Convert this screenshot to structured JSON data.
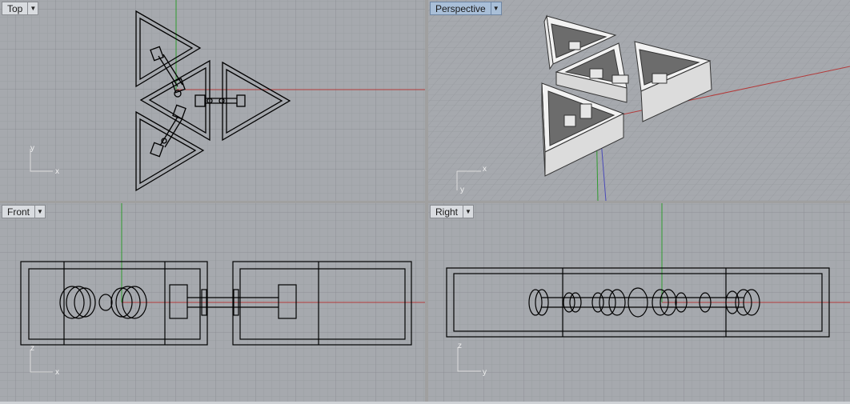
{
  "viewports": {
    "top": {
      "label": "Top",
      "axes": [
        "y",
        "x"
      ]
    },
    "perspective": {
      "label": "Perspective",
      "axes": [
        "x",
        "y"
      ]
    },
    "front": {
      "label": "Front",
      "axes": [
        "z",
        "x"
      ]
    },
    "right": {
      "label": "Right",
      "axes": [
        "z",
        "y"
      ]
    }
  },
  "colors": {
    "grid_bg": "#a6a9ae",
    "grid_minor": "#9b9ea3",
    "grid_major": "#8d9095",
    "axis_x": "#b33a3a",
    "axis_y": "#2f9b2f",
    "axis_z": "#4a4ab8",
    "active_tab": "#a9bfd8",
    "geometry": "#000000"
  },
  "icons": {
    "dropdown": "chevron-down-icon"
  }
}
